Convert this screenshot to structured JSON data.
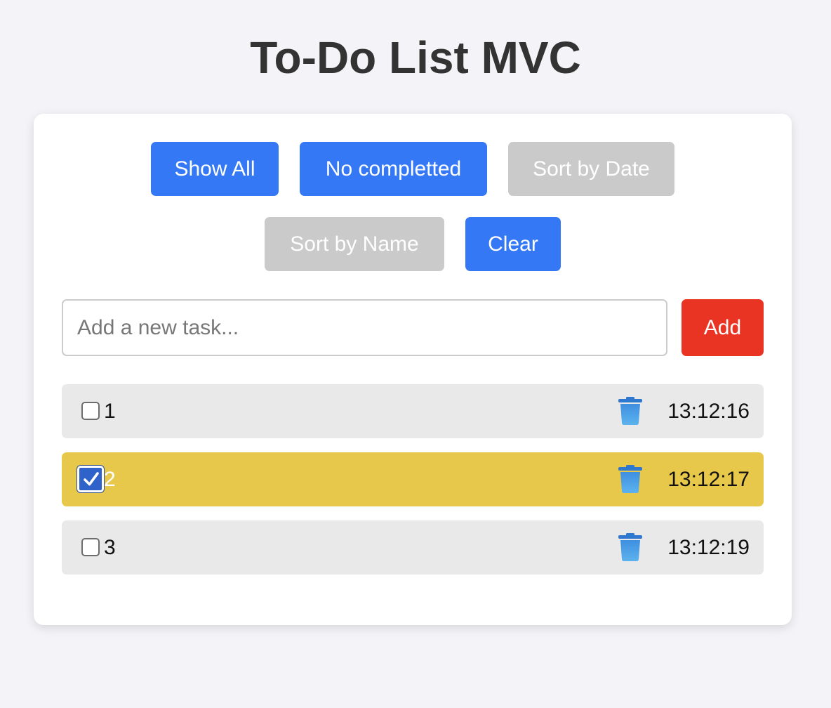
{
  "header": {
    "title": "To-Do List MVC"
  },
  "filters": {
    "show_all": "Show All",
    "no_completed": "No completted",
    "sort_date": "Sort by Date",
    "sort_name": "Sort by Name",
    "clear": "Clear"
  },
  "new_task": {
    "placeholder": "Add a new task...",
    "value": "",
    "add_label": "Add"
  },
  "colors": {
    "primary": "#3578f6",
    "inactive": "#cacaca",
    "danger": "#e93323",
    "completed_row": "#e8c84a",
    "row": "#e9e9e9",
    "trash_icon": "#4aa3e8"
  },
  "todos": [
    {
      "text": "1",
      "time": "13:12:16",
      "completed": false,
      "icon": "trash-icon"
    },
    {
      "text": "2",
      "time": "13:12:17",
      "completed": true,
      "icon": "trash-icon"
    },
    {
      "text": "3",
      "time": "13:12:19",
      "completed": false,
      "icon": "trash-icon"
    }
  ]
}
